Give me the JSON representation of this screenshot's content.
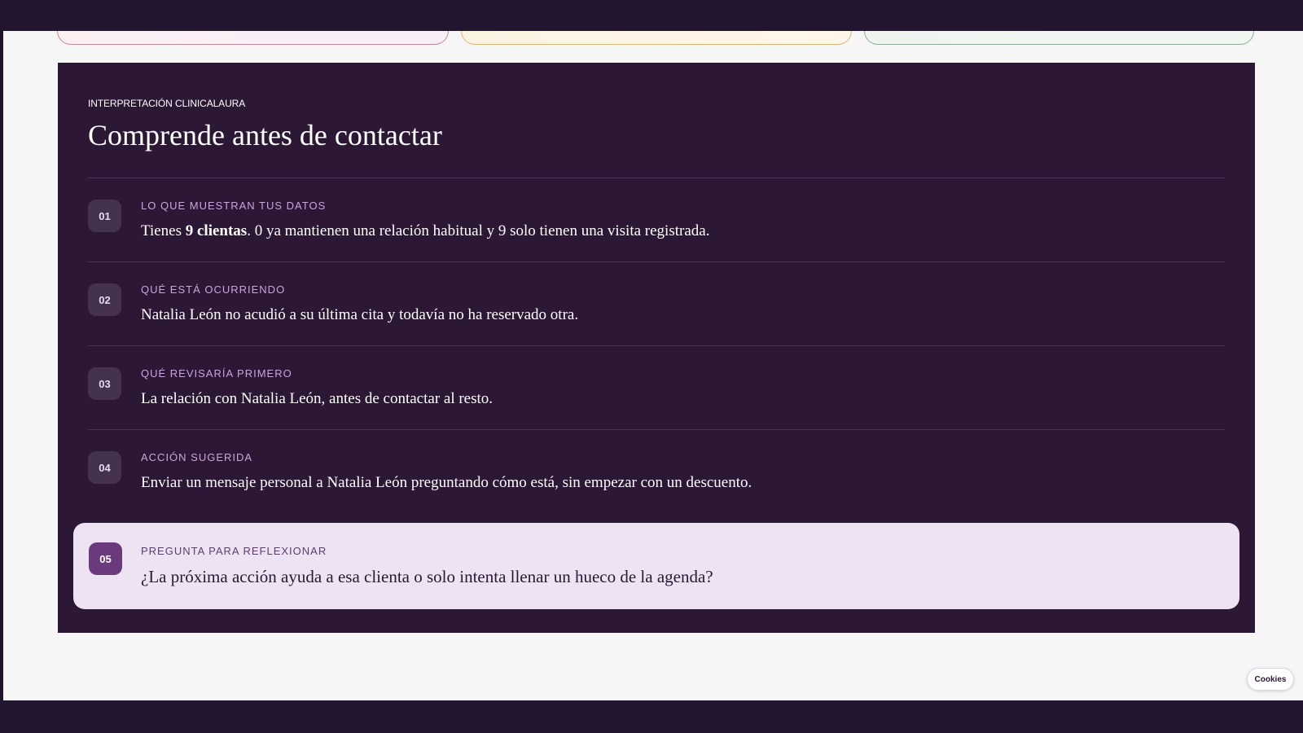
{
  "panel": {
    "eyebrow": "INTERPRETACIÓN CLINICALAURA",
    "title": "Comprende antes de contactar"
  },
  "rows": [
    {
      "number": "01",
      "label": "LO QUE MUESTRAN TUS DATOS",
      "text_before": "Tienes ",
      "text_bold": "9 clientas",
      "text_after": ". 0 ya mantienen una relación habitual y 9 solo tienen una visita registrada."
    },
    {
      "number": "02",
      "label": "QUÉ ESTÁ OCURRIENDO",
      "text": "Natalia León no acudió a su última cita y todavía no ha reservado otra."
    },
    {
      "number": "03",
      "label": "QUÉ REVISARÍA PRIMERO",
      "text": "La relación con Natalia León, antes de contactar al resto."
    },
    {
      "number": "04",
      "label": "ACCIÓN SUGERIDA",
      "text": "Enviar un mensaje personal a Natalia León preguntando cómo está, sin empezar con un descuento."
    },
    {
      "number": "05",
      "label": "PREGUNTA PARA REFLEXIONAR",
      "text": "¿La próxima acción ayuda a esa clienta o solo intenta llenar un hueco de la agenda?"
    }
  ],
  "cookies": {
    "label": "Cookies"
  },
  "colors": {
    "panel_bg": "#2c1734",
    "label_purple": "#c9a4dd",
    "highlight_bg": "#ede3f2",
    "highlight_badge": "#6b3a7d"
  }
}
